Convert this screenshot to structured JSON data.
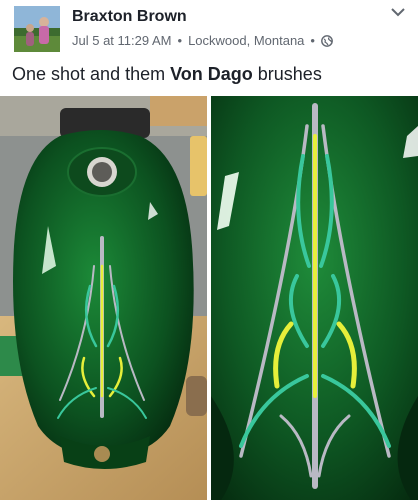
{
  "post": {
    "author": "Braxton Brown",
    "time": "Jul 5 at 11:29 AM",
    "separator": "•",
    "location": "Lockwood, Montana",
    "text_before": "One shot and them ",
    "text_bold": "Von Dago",
    "text_after": " brushes"
  },
  "icons": {
    "privacy": "globe-icon",
    "menu": "chevron-down-icon"
  },
  "colors": {
    "name": "#1d2129",
    "meta": "#616770",
    "tank_green": "#0f5a22",
    "stripe_silver": "#b9b9c4",
    "stripe_yellow": "#e6ef3a",
    "stripe_teal": "#39c79c"
  }
}
